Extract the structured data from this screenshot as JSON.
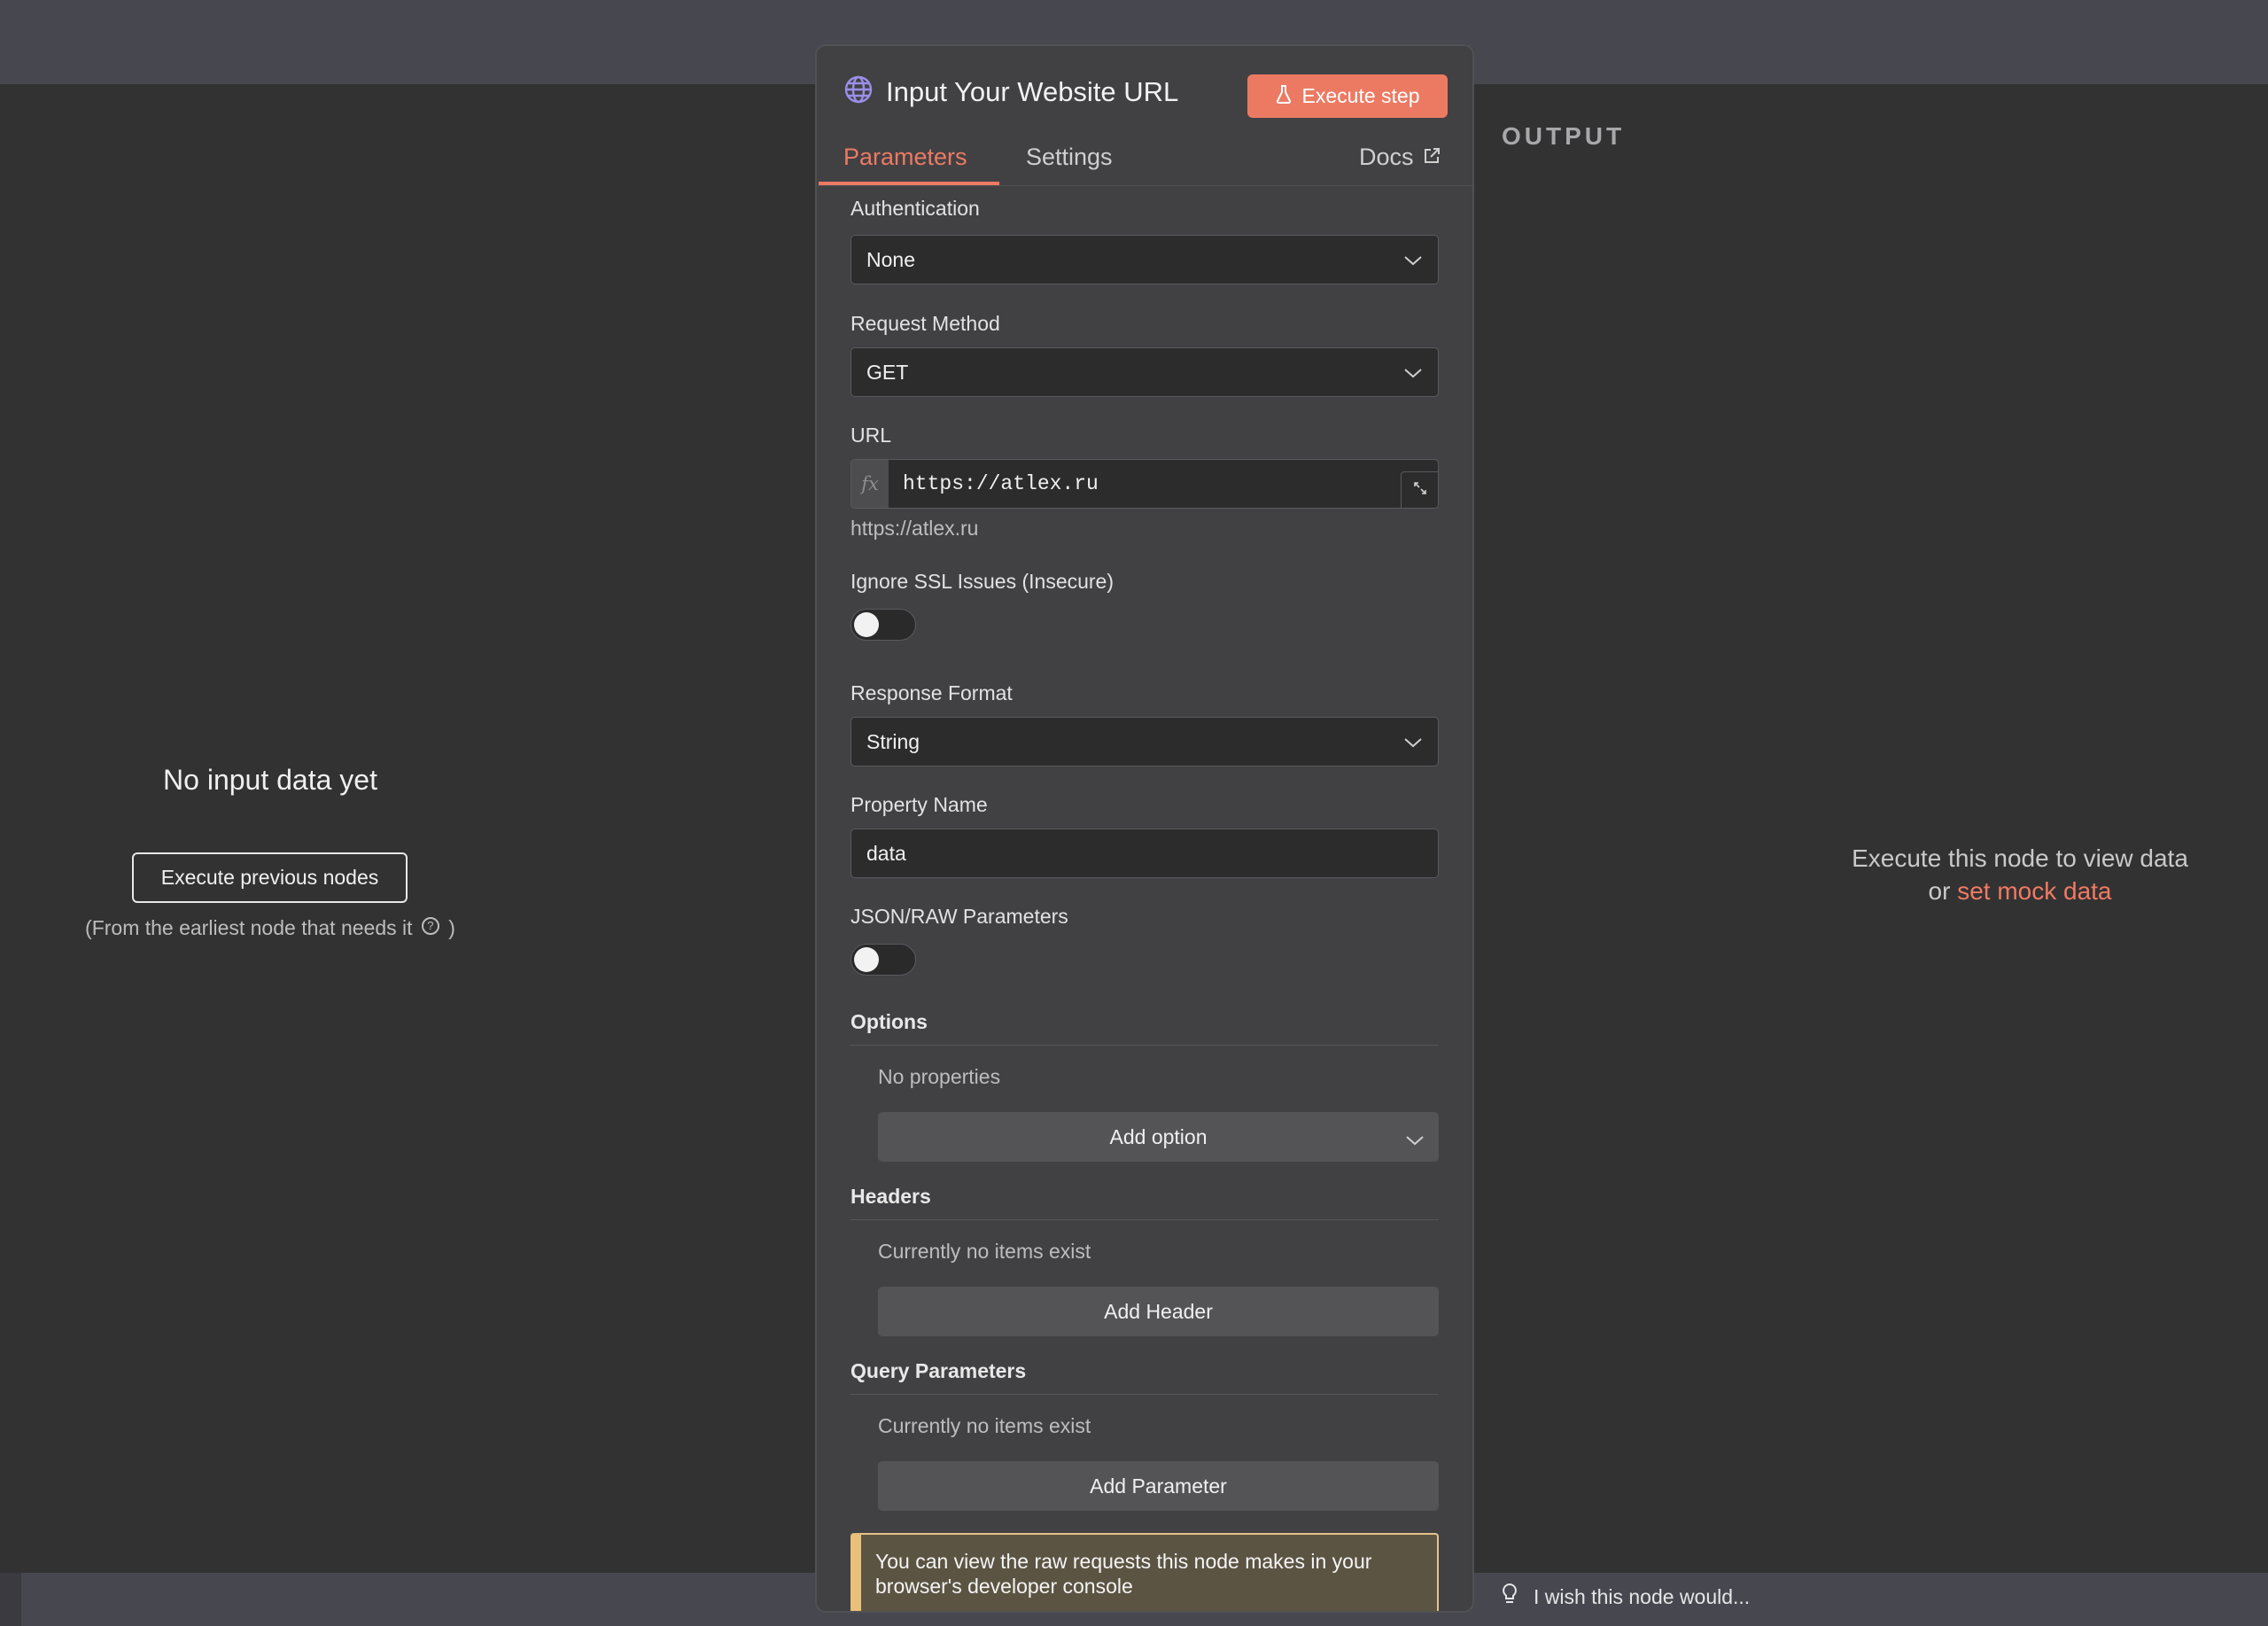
{
  "left_panel": {
    "heading": "No input data yet",
    "execute_previous_label": "Execute previous nodes",
    "note_prefix": "(From the earliest node that needs it",
    "note_suffix": ")"
  },
  "right_panel": {
    "output_label": "OUTPUT",
    "hint_line1": "Execute this node to view data",
    "hint_or": "or",
    "mock_link": "set mock data",
    "feedback_text": "I wish this node would..."
  },
  "node": {
    "title": "Input Your Website URL",
    "execute_label": "Execute step",
    "tabs": [
      "Parameters",
      "Settings"
    ],
    "docs_label": "Docs",
    "active_tab": "Parameters"
  },
  "params": {
    "authentication": {
      "label": "Authentication",
      "value": "None"
    },
    "request_method": {
      "label": "Request Method",
      "value": "GET"
    },
    "url": {
      "label": "URL",
      "fx": "fx",
      "value": "https://atlex.ru",
      "preview": "https://atlex.ru"
    },
    "ignore_ssl": {
      "label": "Ignore SSL Issues (Insecure)",
      "enabled": false
    },
    "response_format": {
      "label": "Response Format",
      "value": "String"
    },
    "property_name": {
      "label": "Property Name",
      "value": "data"
    },
    "json_raw": {
      "label": "JSON/RAW Parameters",
      "enabled": false
    },
    "options": {
      "label": "Options",
      "empty_text": "No properties",
      "add_label": "Add option"
    },
    "headers": {
      "label": "Headers",
      "empty_text": "Currently no items exist",
      "add_label": "Add Header"
    },
    "query_parameters": {
      "label": "Query Parameters",
      "empty_text": "Currently no items exist",
      "add_label": "Add Parameter"
    },
    "notice": "You can view the raw requests this node makes in your browser's developer console"
  },
  "colors": {
    "accent": "#ec7a63",
    "panel_bg": "#414143",
    "canvas_bg": "#323233",
    "notice_border": "#e8c07a"
  }
}
